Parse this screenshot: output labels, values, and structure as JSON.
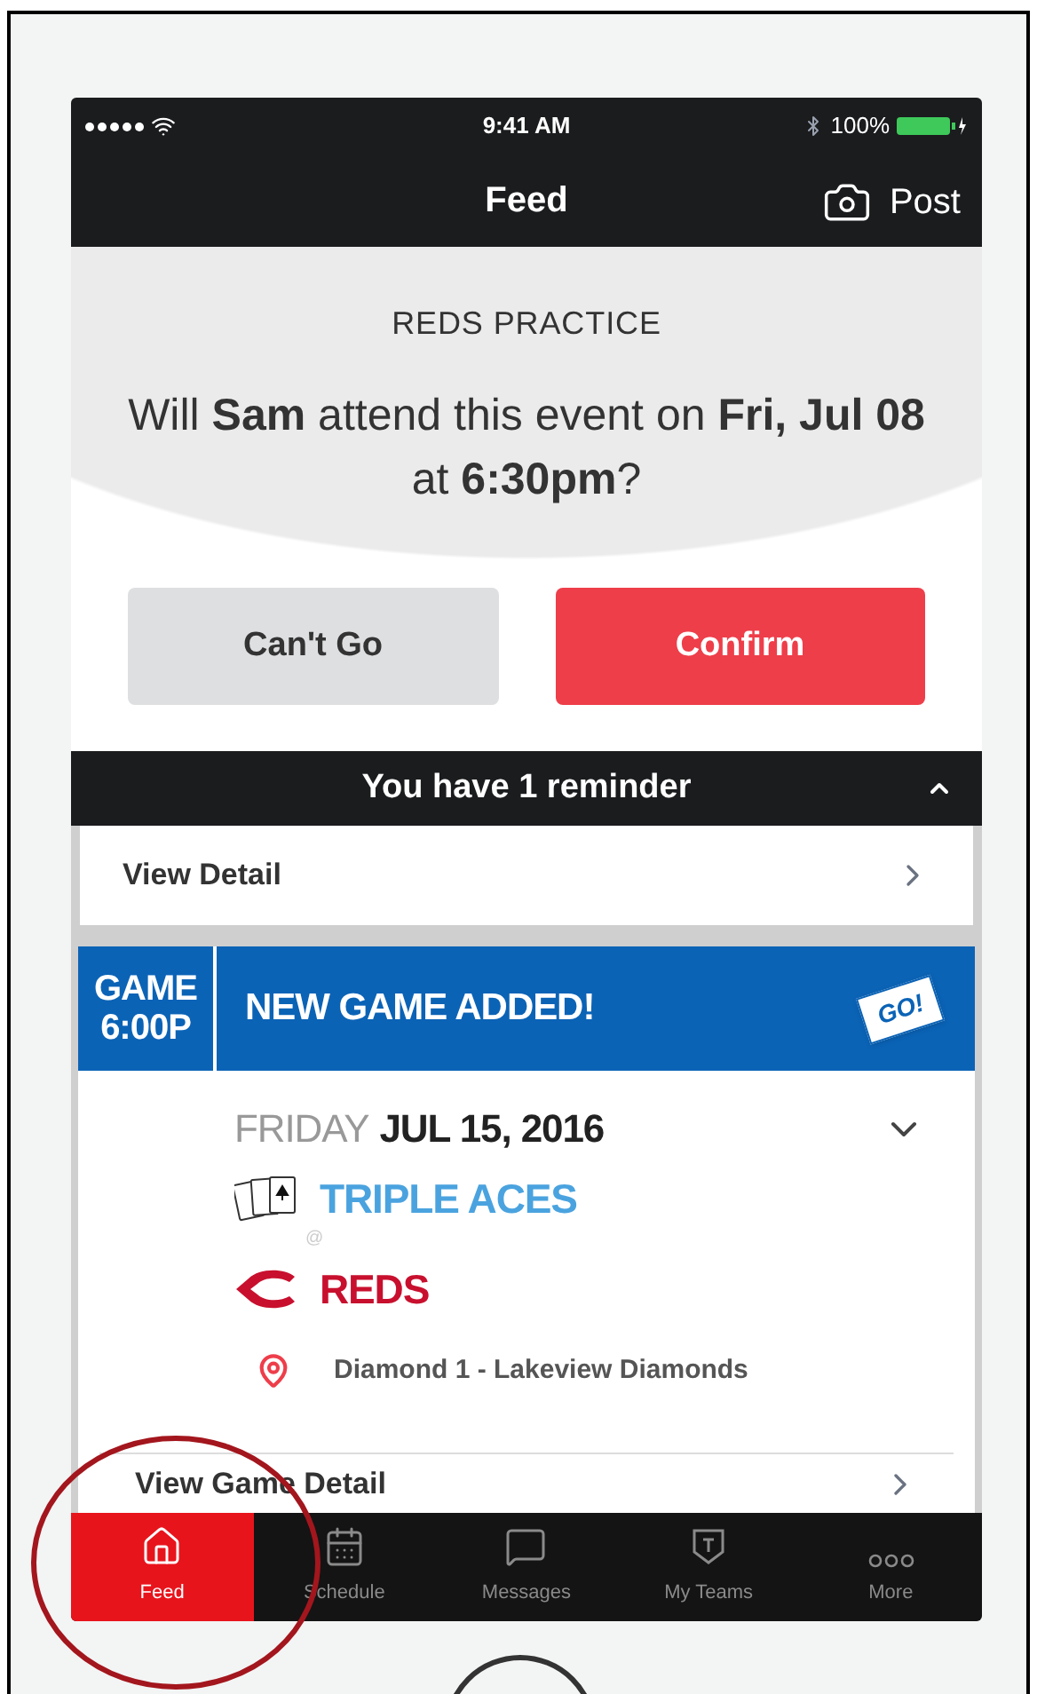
{
  "status_bar": {
    "time": "9:41 AM",
    "battery": "100%"
  },
  "nav_bar": {
    "title": "Feed",
    "action": "Post"
  },
  "event": {
    "title": "REDS PRACTICE",
    "question": "Will **Sam** attend this event on **Fri, Jul 08** at **6:30pm**?",
    "buttons": [
      {
        "label": "Can't Go",
        "kind": "secondary"
      },
      {
        "label": "Confirm",
        "kind": "primary"
      }
    ]
  },
  "reminder": {
    "text": "You have 1 reminder",
    "expanded": true
  },
  "detail_link": "View Detail",
  "game": {
    "badge": [
      "GAME",
      "6:00P"
    ],
    "headline": "NEW GAME ADDED!",
    "flag": "GO!",
    "day": "FRIDAY",
    "date": "JUL 15, 2016",
    "expanded": false,
    "teams": [
      {
        "name": "TRIPLE ACES",
        "color": "#4aa3df",
        "kind": "cards"
      },
      {
        "name": "REDS",
        "color": "#c8102e",
        "kind": "c-logo"
      }
    ],
    "separator": "@",
    "location": "Diamond 1 - Lakeview Diamonds",
    "link": "View Game Detail"
  },
  "tabs": [
    {
      "label": "Feed",
      "kind": "home",
      "selected": true
    },
    {
      "label": "Schedule",
      "kind": "calendar",
      "selected": false
    },
    {
      "label": "Messages",
      "kind": "chat",
      "selected": false
    },
    {
      "label": "My Teams",
      "kind": "shield",
      "selected": false
    },
    {
      "label": "More",
      "kind": "more",
      "selected": false
    }
  ]
}
